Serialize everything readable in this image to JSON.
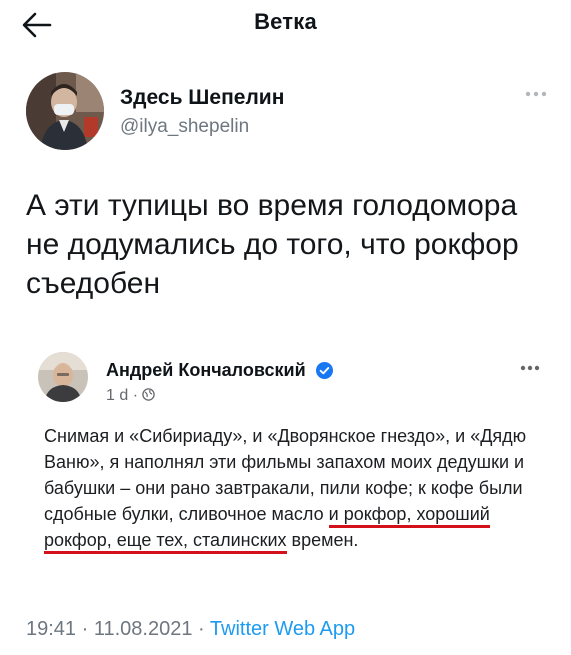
{
  "header": {
    "title": "Ветка"
  },
  "tweet": {
    "author_name": "Здесь Шепелин",
    "author_handle": "@ilya_shepelin",
    "text": "А эти тупицы во время голодомора не додумались до того, что рокфор съедобен"
  },
  "embedded_post": {
    "author_name": "Андрей Кончаловский",
    "meta_time": "1 d",
    "meta_dot": "·",
    "text_before": "Снимая и «Сибириаду», и «Дворянское гнездо», и «Дядю Ваню», я наполнял эти фильмы запахом моих дедушки и бабушки – они рано завтракали, пили кофе; к кофе были сдобные булки, сливочное масло ",
    "text_underlined": "и рокфор, хороший рокфор, еще тех, сталинских",
    "text_after": " времен."
  },
  "footer": {
    "time": "19:41",
    "separator": " · ",
    "date": "11.08.2021",
    "separator2": " · ",
    "source": "Twitter Web App"
  },
  "colors": {
    "accent": "#1d9bf0",
    "underline": "#d4111a",
    "muted": "#6e7780",
    "verified": "#1877f2"
  },
  "icons": [
    "back-arrow-icon",
    "more-dots-icon",
    "verified-badge-icon",
    "globe-icon"
  ]
}
